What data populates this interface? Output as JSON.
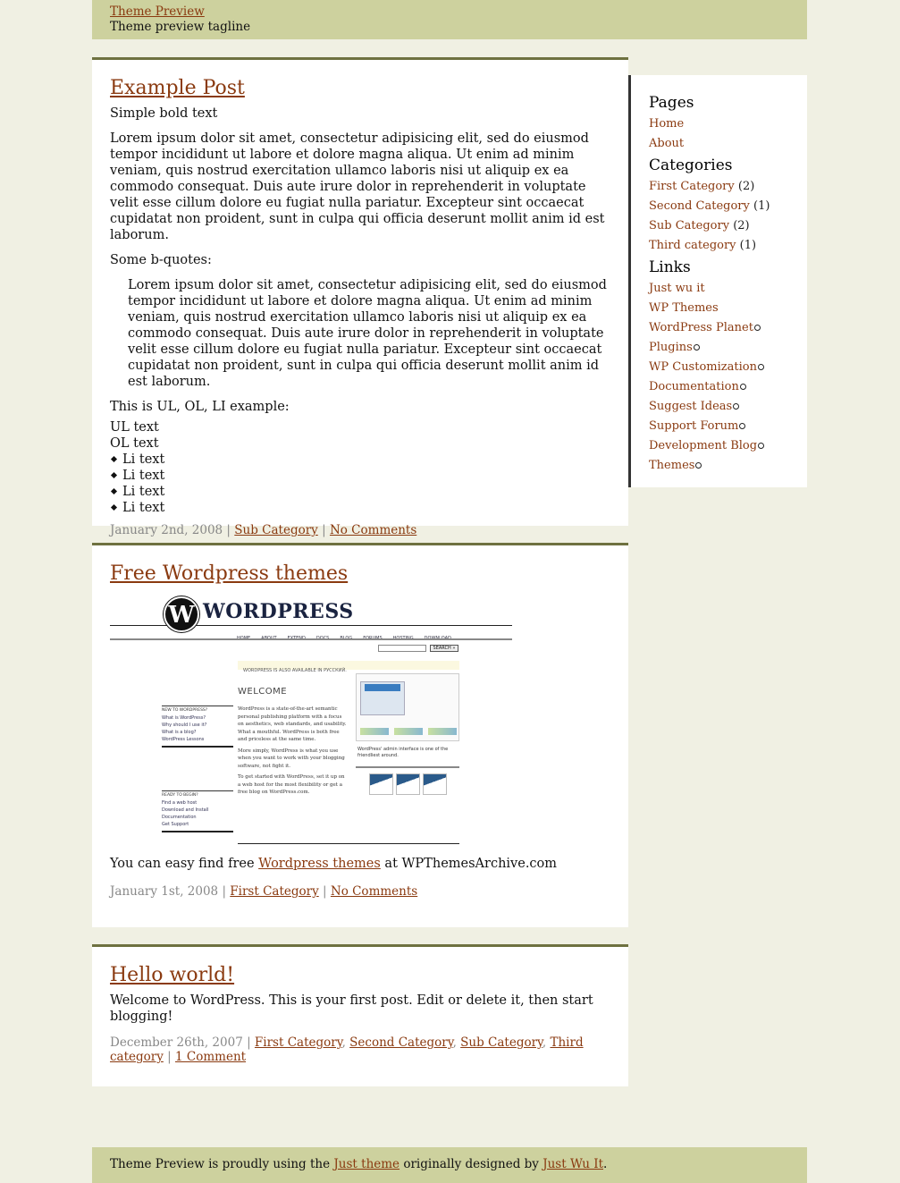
{
  "header": {
    "blog_title": "Theme Preview",
    "tagline": "Theme preview tagline"
  },
  "posts": [
    {
      "title": "Example Post",
      "body": {
        "bold_line": "Simple bold text",
        "paragraph": "Lorem ipsum dolor sit amet, consectetur adipisicing elit, sed do eiusmod tempor incididunt ut labore et dolore magna aliqua. Ut enim ad minim veniam, quis nostrud exercitation ullamco laboris nisi ut aliquip ex ea commodo consequat. Duis aute irure dolor in reprehenderit in voluptate velit esse cillum dolore eu fugiat nulla pariatur. Excepteur sint occaecat cupidatat non proident, sunt in culpa qui officia deserunt mollit anim id est laborum.",
        "bquote_label": "Some b-quotes:",
        "blockquote": "Lorem ipsum dolor sit amet, consectetur adipisicing elit, sed do eiusmod tempor incididunt ut labore et dolore magna aliqua. Ut enim ad minim veniam, quis nostrud exercitation ullamco laboris nisi ut aliquip ex ea commodo consequat. Duis aute irure dolor in reprehenderit in voluptate velit esse cillum dolore eu fugiat nulla pariatur. Excepteur sint occaecat cupidatat non proident, sunt in culpa qui officia deserunt mollit anim id est laborum.",
        "list_label": "This is UL, OL, LI example:",
        "ul_text": "UL text",
        "ol_text": "OL text",
        "li_items": [
          "Li text",
          "Li text",
          "Li text",
          "Li text"
        ]
      },
      "meta": {
        "date": "January 2nd, 2008",
        "categories": [
          "Sub Category"
        ],
        "comments": "No Comments"
      }
    },
    {
      "title": "Free Wordpress themes",
      "image": {
        "logo_letter": "W",
        "logo_text": "WORDPRESS",
        "nav": [
          "HOME",
          "ABOUT",
          "EXTEND",
          "DOCS",
          "BLOG",
          "FORUMS",
          "HOSTING",
          "DOWNLOAD"
        ],
        "search_button": "SEARCH »",
        "notice": "WORDPRESS IS ALSO AVAILABLE IN РУССКИЙ.",
        "welcome": "WELCOME",
        "new_heading": "NEW TO WORDPRESS?",
        "new_links": [
          "What is WordPress?",
          "Why should I use it?",
          "What is a blog?",
          "WordPress Lessons"
        ],
        "ready_heading": "READY TO BEGIN?",
        "ready_links": [
          "Find a web host",
          "Download and Install",
          "Documentation",
          "Get Support"
        ],
        "para1": "WordPress is a state-of-the-art semantic personal publishing platform with a focus on aesthetics, web standards, and usability. What a mouthful. WordPress is both free and priceless at the same time.",
        "para2": "More simply, WordPress is what you use when you want to work with your blogging software, not fight it.",
        "para3": "To get started with WordPress, set it up on a web host for the most flexibility or get a free blog on WordPress.com.",
        "caption": "WordPress' admin interface is one of the friendliest around."
      },
      "body": {
        "text_before": "You can easy find free ",
        "link": "Wordpress themes",
        "text_after": " at WPThemesArchive.com"
      },
      "meta": {
        "date": "January 1st, 2008",
        "categories": [
          "First Category"
        ],
        "comments": "No Comments"
      }
    },
    {
      "title": "Hello world!",
      "body": {
        "paragraph": "Welcome to WordPress. This is your first post. Edit or delete it, then start blogging!"
      },
      "meta": {
        "date": "December 26th, 2007",
        "categories": [
          "First Category",
          "Second Category",
          "Sub Category",
          "Third category"
        ],
        "comments": "1 Comment"
      }
    }
  ],
  "sidebar": {
    "pages_heading": "Pages",
    "pages": [
      "Home",
      "About"
    ],
    "categories_heading": "Categories",
    "categories": [
      {
        "label": "First Category",
        "count": "(2)"
      },
      {
        "label": "Second Category",
        "count": "(1)"
      },
      {
        "label": "Sub Category",
        "count": "(2)"
      },
      {
        "label": "Third category",
        "count": "(1)"
      }
    ],
    "links_heading": "Links",
    "links": [
      {
        "label": "Just wu it",
        "external": false
      },
      {
        "label": "WP Themes",
        "external": false
      },
      {
        "label": "WordPress Planet",
        "external": true
      },
      {
        "label": "Plugins",
        "external": true
      },
      {
        "label": "WP Customization",
        "external": true
      },
      {
        "label": "Documentation",
        "external": true
      },
      {
        "label": "Suggest Ideas",
        "external": true
      },
      {
        "label": "Support Forum",
        "external": true
      },
      {
        "label": "Development Blog",
        "external": true
      },
      {
        "label": "Themes",
        "external": true
      }
    ]
  },
  "footer": {
    "text1": "Theme Preview is proudly using the ",
    "theme_link": "Just theme",
    "text2": " originally designed by ",
    "designer_link": "Just Wu It",
    "text3": "."
  },
  "separator": " | "
}
